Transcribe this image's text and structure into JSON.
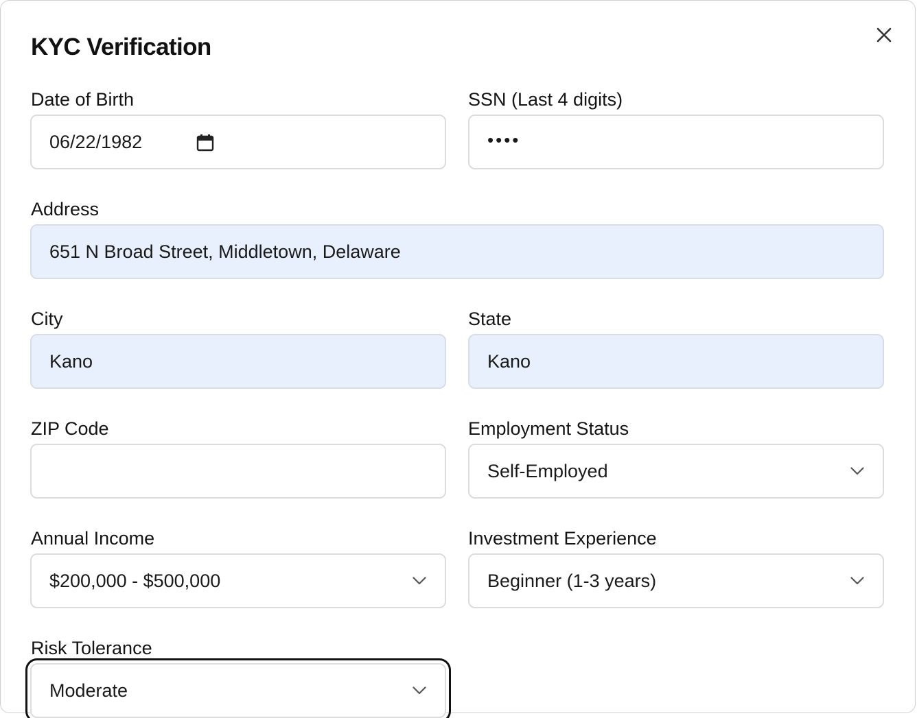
{
  "dialog": {
    "title": "KYC Verification",
    "close_icon": "close-icon"
  },
  "fields": {
    "dob": {
      "label": "Date of Birth",
      "value": "06/22/1982",
      "icon": "calendar-icon"
    },
    "ssn": {
      "label": "SSN (Last 4 digits)",
      "value": "••••"
    },
    "address": {
      "label": "Address",
      "value": "651 N Broad Street, Middletown, Delaware"
    },
    "city": {
      "label": "City",
      "value": "Kano"
    },
    "state": {
      "label": "State",
      "value": "Kano"
    },
    "zip": {
      "label": "ZIP Code",
      "value": ""
    },
    "employment": {
      "label": "Employment Status",
      "value": "Self-Employed",
      "icon": "chevron-down-icon"
    },
    "income": {
      "label": "Annual Income",
      "value": "$200,000 - $500,000",
      "icon": "chevron-down-icon"
    },
    "experience": {
      "label": "Investment Experience",
      "value": "Beginner (1-3 years)",
      "icon": "chevron-down-icon"
    },
    "risk": {
      "label": "Risk Tolerance",
      "value": "Moderate",
      "icon": "chevron-down-icon"
    }
  },
  "colors": {
    "autofill_bg": "#e8f0fe",
    "border": "#dcdcdc",
    "focus_ring": "#111111",
    "text": "#111111"
  }
}
